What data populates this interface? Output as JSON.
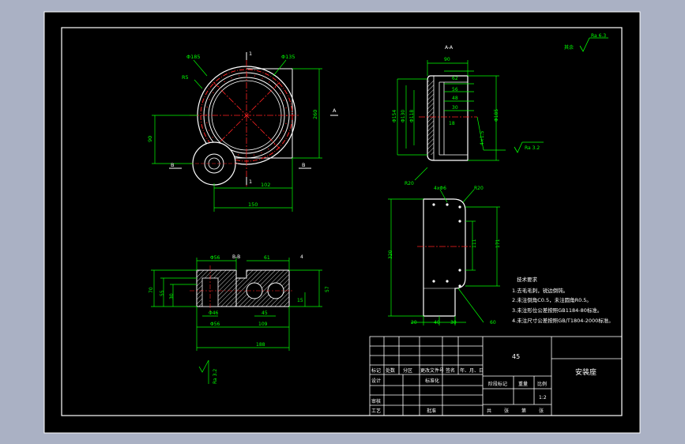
{
  "colors": {
    "viewport": "#aab1c4",
    "paper": "#000000",
    "line": "#ffffff",
    "dim": "#00ff00",
    "center": "#ff2222",
    "hatch": "#ffffff"
  },
  "drawing": {
    "title": "安装座",
    "material": "45",
    "scale": "1:2",
    "roughness_main": "Ra 6.3",
    "roughness_note": "其余",
    "section_aa": "A-A",
    "section_bb": "B-B",
    "marks": {
      "A": "A",
      "B": "B",
      "one": "1",
      "four": "4"
    }
  },
  "dims": {
    "top_view": {
      "phi_outer": "Φ185",
      "phi_inner": "Φ135",
      "r": "R5",
      "height": "260",
      "offset": "90",
      "w1": "102",
      "w2": "150"
    },
    "section_a": {
      "w_top": "90",
      "d1": "62",
      "d2": "56",
      "d3": "48",
      "d4": "30",
      "d5": "18",
      "phi_left_1": "Φ154",
      "phi_left_2": "Φ130",
      "phi_left_3": "Φ118",
      "phi_right": "Φ185",
      "chamfer": "4×1.5",
      "ra": "Ra 3.2",
      "r_bottom": "R20"
    },
    "side_view": {
      "top": "4xΦ6",
      "r": "R20",
      "h": "320",
      "h2": "111",
      "h3": "171",
      "b1": "20",
      "b2": "40",
      "b3": "30",
      "angle": "60"
    },
    "section_b": {
      "t1": "Φ56",
      "t2": "61",
      "h_left": "70",
      "h_left2": "55",
      "h_left3": "30",
      "bot1": "Φ46",
      "bot2": "45",
      "bot3": "Φ56",
      "bot4": "109",
      "total": "188",
      "h_right": "57",
      "h_right2": "15",
      "ra": "Ra 3.2"
    }
  },
  "tech_notes": {
    "title": "技术要求",
    "items": [
      "1.去毛毛刺，锐边倒钝。",
      "2.未注倒角C0.5，未注圆角R0.5。",
      "3.未注形位公差按照GB1184-80标准。",
      "4.未注尺寸公差按照GB/T1804-2000标准。"
    ]
  },
  "title_block": {
    "row_labels": [
      "标记",
      "处数",
      "分区",
      "更改文件号",
      "签名",
      "年、月、日"
    ],
    "design": "设计",
    "standard": "标准化",
    "review": "审核",
    "process": "工艺",
    "approve": "批准",
    "stage": "阶段标记",
    "weight": "重量",
    "scale_label": "比例",
    "sheets": [
      "共",
      "张",
      "第",
      "张"
    ]
  }
}
